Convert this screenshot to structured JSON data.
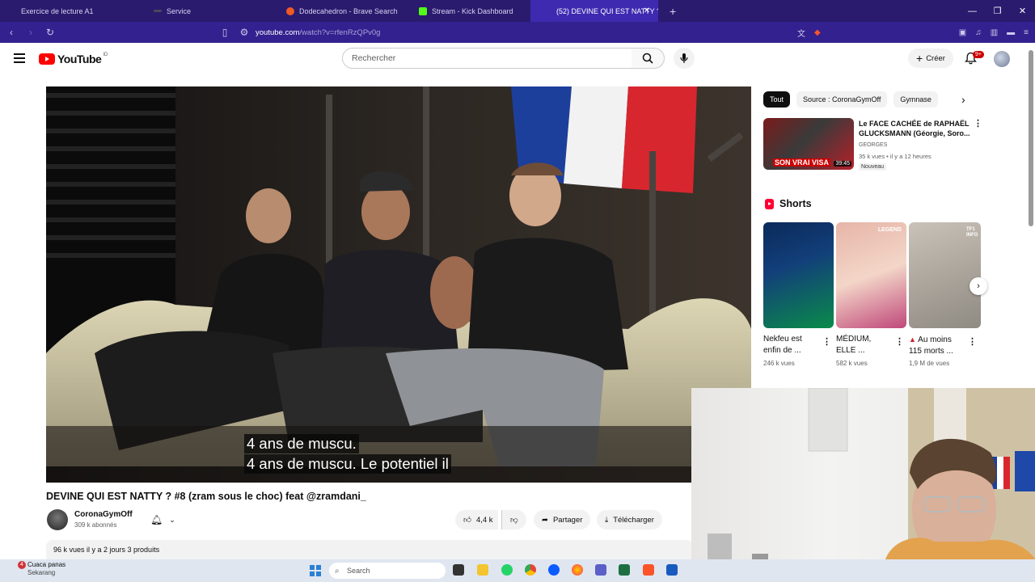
{
  "browser": {
    "tabs": [
      {
        "title": "Exercice de lecture A1",
        "color": "#9aa0a6"
      },
      {
        "title": "Service",
        "color": "#6b6b6b"
      },
      {
        "title": "Dodecahedron - Brave Search",
        "color": "#f15a24"
      },
      {
        "title": "Stream - Kick Dashboard",
        "color": "#53fc18"
      },
      {
        "title": "(52) DEVINE QUI EST NATTY ?",
        "color": "#ff0000",
        "active": true
      }
    ],
    "new_tab": "+",
    "url_host": "youtube.com",
    "url_path": "/watch?v=rfenRzQPv0g"
  },
  "youtube": {
    "logo_text": "YouTube",
    "logo_region": "ID",
    "search_placeholder": "Rechercher",
    "create_label": "Créer",
    "notif_count": "9+",
    "video": {
      "caption_line1": "4 ans de muscu.",
      "caption_line2": "4 ans de muscu. Le potentiel il",
      "title": "DEVINE QUI EST NATTY ? #8 (zram sous le choc) feat @zramdani_",
      "channel_name": "CoronaGymOff",
      "channel_subs": "309 k abonnés",
      "likes": "4,4 k",
      "share_label": "Partager",
      "download_label": "Télécharger",
      "desc_meta": "96 k vues  il y a 2 jours  3 produits"
    },
    "chips": [
      {
        "label": "Tout",
        "active": true
      },
      {
        "label": "Source : CoronaGymOff"
      },
      {
        "label": "Gymnase"
      }
    ],
    "recommended": {
      "title": "Le FACE CACHÉE de RAPHAËL GLUCKSMANN (Géorgie, Soro...",
      "channel": "GEORGES",
      "meta": "35 k vues • il y a 12 heures",
      "badge": "Nouveau",
      "duration": "39:45",
      "thumb_text": "SON VRAI VISA"
    },
    "shorts_heading": "Shorts",
    "shorts": [
      {
        "title": "Nekfeu est enfin de ...",
        "views": "246 k vues"
      },
      {
        "title": "MÉDIUM, ELLE ...",
        "views": "582 k vues",
        "thumb_text": "LEGEND"
      },
      {
        "title": "Au moins 115 morts ...",
        "views": "1,9 M de vues",
        "thumb_text": "TF1 INFO"
      }
    ]
  },
  "taskbar": {
    "weather_title": "Cuaca panas",
    "weather_sub": "Sekarang",
    "weather_badge": "4",
    "search_label": "Search"
  }
}
